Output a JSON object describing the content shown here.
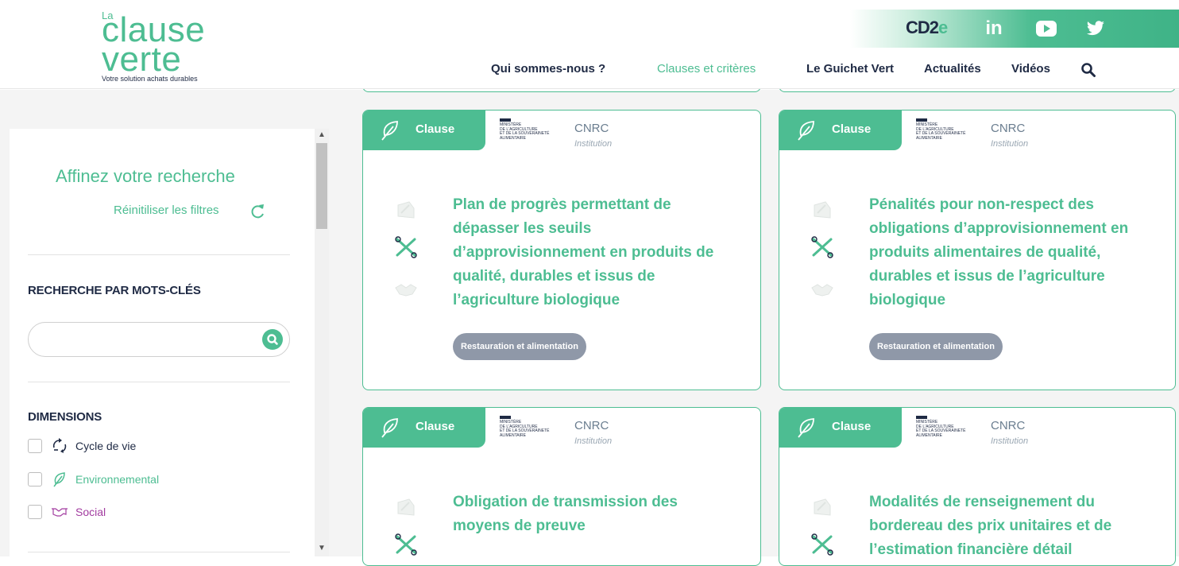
{
  "brand": {
    "logo_la": "La",
    "logo_word1": "clause",
    "logo_word2": "verte",
    "tagline": "Votre solution achats durables",
    "partner": "CD2e"
  },
  "social": [
    "linkedin-icon",
    "youtube-icon",
    "twitter-icon"
  ],
  "nav": {
    "items": [
      {
        "label": "Qui sommes-nous ?"
      },
      {
        "label": "Clauses et critères"
      },
      {
        "label": "Le Guichet Vert"
      },
      {
        "label": "Actualités"
      },
      {
        "label": "Vidéos"
      }
    ],
    "active_index": 1
  },
  "sidebar": {
    "title": "Affinez votre recherche",
    "reset_label": "Réinitiliser les filtres",
    "keywords_title": "RECHERCHE PAR MOTS-CLÉS",
    "search_value": "",
    "search_placeholder": "",
    "dimensions_title": "DIMENSIONS",
    "dimensions": [
      {
        "label": "Cycle de vie",
        "icon": "cycle-icon",
        "color": "#1f2a44",
        "checked": false
      },
      {
        "label": "Environnemental",
        "icon": "leaf-icon",
        "color": "#4dbd92",
        "checked": false
      },
      {
        "label": "Social",
        "icon": "handshake-icon",
        "color": "#a23ca0",
        "checked": false
      }
    ]
  },
  "cards": [
    {
      "type": "Clause",
      "ministry": "MINISTÈRE\nDE L'AGRICULTURE\nET DE LA SOUVERAINETÉ\nALIMENTAIRE",
      "institution_name": "CNRC",
      "institution_label": "Institution",
      "title": "Plan de progrès permettant de dépasser les seuils d’approvisionnement en produits de qualité, durables et issus de l’agriculture biologique",
      "tag": "Restauration et alimentation"
    },
    {
      "type": "Clause",
      "ministry": "MINISTÈRE\nDE L'AGRICULTURE\nET DE LA SOUVERAINETÉ\nALIMENTAIRE",
      "institution_name": "CNRC",
      "institution_label": "Institution",
      "title": "Pénalités pour non-respect des obligations d’approvisionnement en produits alimentaires de qualité, durables et issus de l’agriculture biologique",
      "tag": "Restauration et alimentation"
    },
    {
      "type": "Clause",
      "ministry": "MINISTÈRE\nDE L'AGRICULTURE\nET DE LA SOUVERAINETÉ\nALIMENTAIRE",
      "institution_name": "CNRC",
      "institution_label": "Institution",
      "title": "Obligation de transmission des moyens de preuve",
      "tag": ""
    },
    {
      "type": "Clause",
      "ministry": "MINISTÈRE\nDE L'AGRICULTURE\nET DE LA SOUVERAINETÉ\nALIMENTAIRE",
      "institution_name": "CNRC",
      "institution_label": "Institution",
      "title": "Modalités de renseignement du bordereau des prix unitaires et de l’estimation financière détail",
      "tag": ""
    }
  ],
  "colors": {
    "accent": "#4dbd92",
    "navy": "#1f2a44",
    "tag_bg": "#8f98a8",
    "social_purple": "#a23ca0"
  }
}
